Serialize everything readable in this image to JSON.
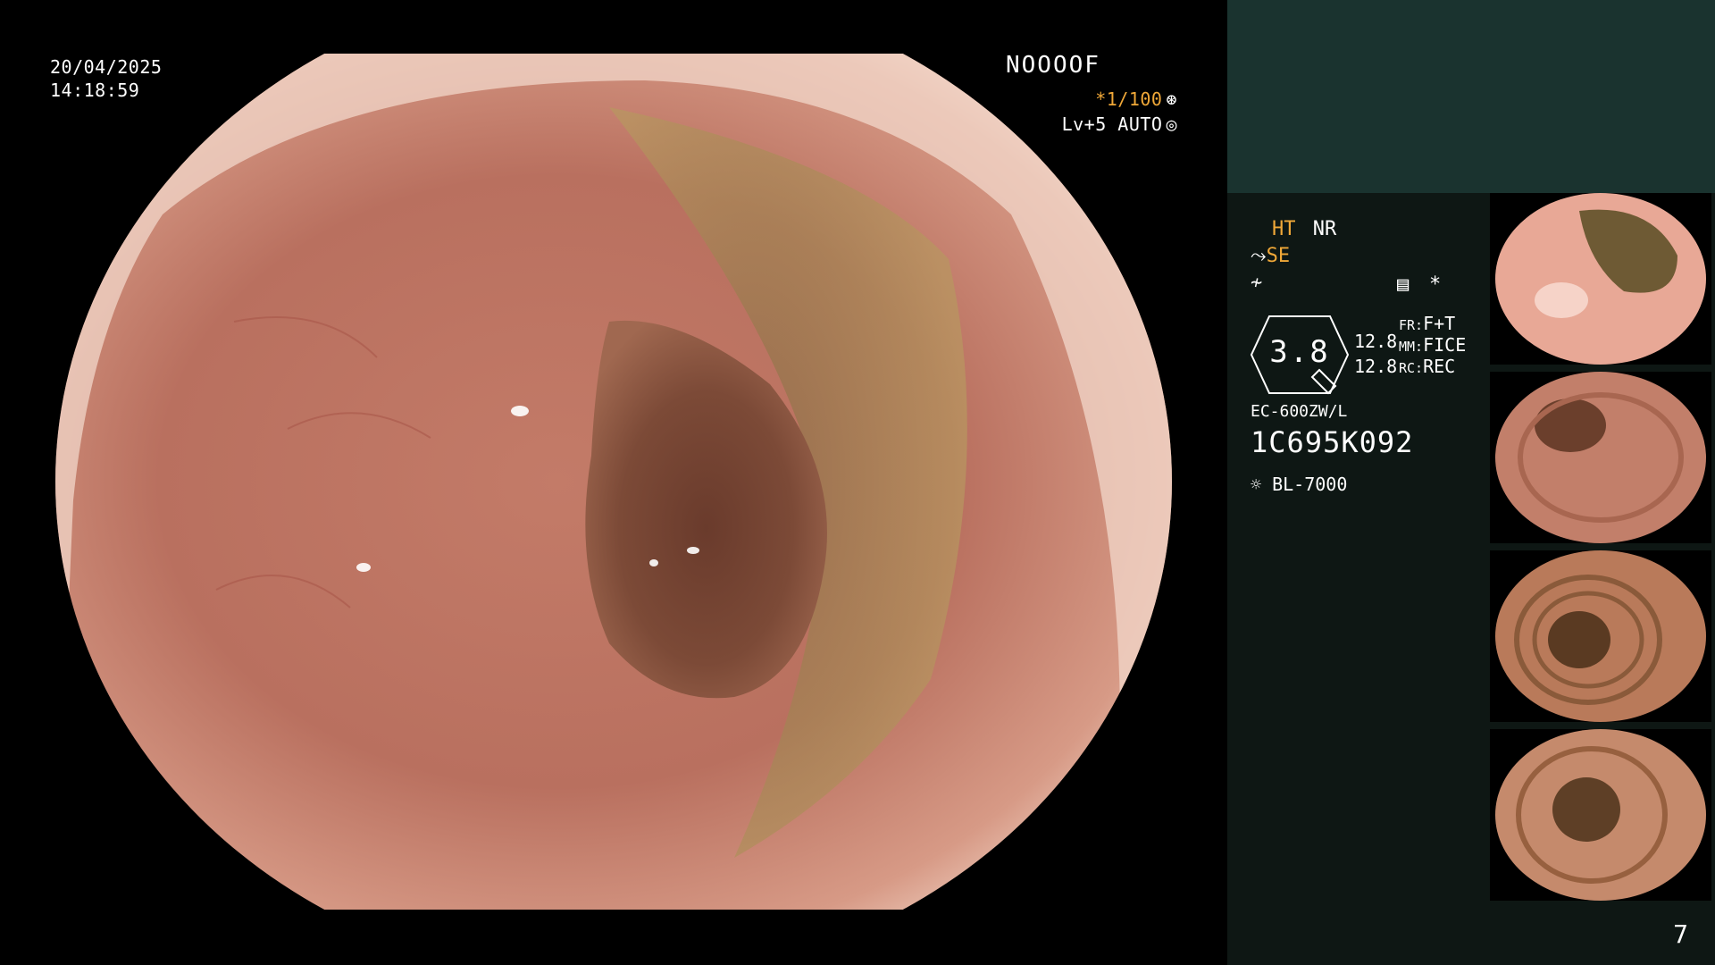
{
  "overlay": {
    "date": "20/04/2025",
    "time": "14:18:59",
    "patient_id": "NOOOOF",
    "shutter": "*1/100",
    "shutter_icon": "aperture-icon",
    "level": "Lv+5 AUTO",
    "level_icon": "iris-icon"
  },
  "panel": {
    "ht": "HT",
    "nr": "NR",
    "se": "SE",
    "se_icon": "scope-tip-icon",
    "freeze_icon": "freeze-icon",
    "memo_icon": "memo-icon",
    "asterisk": "*",
    "gauge_value": "3.8",
    "val1": "12.8",
    "val2": "12.8",
    "fr_label": "FR:",
    "fr_value": "F+T",
    "mm_label": "MM:",
    "mm_value": "FICE",
    "rc_label": "RC:",
    "rc_value": "REC",
    "scope_model": "EC-600ZW/L",
    "scope_serial": "1C695K092",
    "light_icon": "light-source-icon",
    "light_source": "BL-7000",
    "frame_count": "7"
  },
  "colors": {
    "accent_orange": "#f0a838",
    "panel_bg": "#0e1714",
    "panel_top_bg": "#1a332f"
  }
}
